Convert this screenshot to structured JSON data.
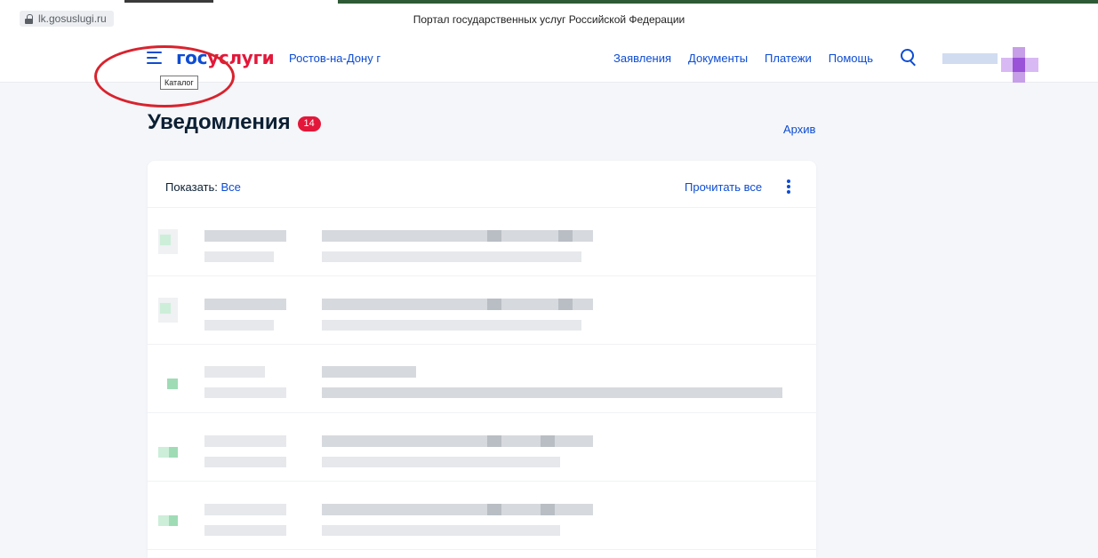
{
  "browser": {
    "url": "lk.gosuslugi.ru",
    "page_title": "Портал государственных услуг Российской Федерации"
  },
  "header": {
    "logo_part1": "гос",
    "logo_part2": "услуги",
    "region": "Ростов-на-Дону г",
    "nav": [
      "Заявления",
      "Документы",
      "Платежи",
      "Помощь"
    ],
    "menu_tooltip": "Каталог"
  },
  "page": {
    "title": "Уведомления",
    "unread_count": "14",
    "archive_label": "Архив"
  },
  "toolbar": {
    "show_label": "Показать:",
    "show_value": "Все",
    "read_all_label": "Прочитать все"
  },
  "colors": {
    "accent": "#0d4cd3",
    "brand_red": "#e3173a",
    "background": "#f4f6f9",
    "annotation_circle": "#d8232e"
  },
  "icons": [
    "lock-icon",
    "menu-icon",
    "search-icon",
    "kebab-menu-icon"
  ]
}
